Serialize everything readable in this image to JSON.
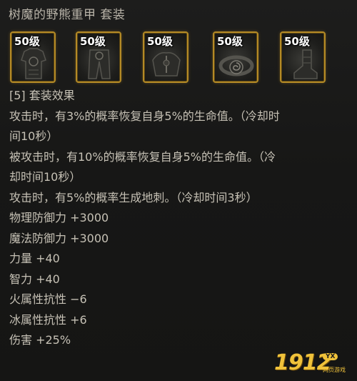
{
  "set": {
    "title": "树魔的野熊重甲  套装",
    "slots": [
      {
        "level": "50级",
        "icon": "armor-chest-icon"
      },
      {
        "level": "50级",
        "icon": "armor-pants-icon"
      },
      {
        "level": "50级",
        "icon": "armor-shoulder-icon"
      },
      {
        "level": "50级",
        "icon": "armor-belt-icon"
      },
      {
        "level": "50级",
        "icon": "armor-boots-icon"
      }
    ]
  },
  "effects": {
    "header": "[5] 套装效果",
    "lines": [
      "攻击时，有3%的概率恢复自身5%的生命值。（冷却时",
      "间10秒）",
      "被攻击时，有10%的概率恢复自身5%的生命值。（冷",
      "却时间10秒）",
      "攻击时，有5%的概率生成地刺。（冷却时间3秒）"
    ]
  },
  "stats": [
    "物理防御力 +3000",
    "魔法防御力 +3000",
    "力量 +40",
    "智力 +40",
    "火属性抗性 −6",
    "冰属性抗性 +6",
    "伤害 +25%"
  ],
  "watermark": {
    "number": "1912",
    "badge": "YX",
    "subtitle": "网页游戏"
  },
  "colors": {
    "slot_border": "#b48a26",
    "text": "#c6c1b5",
    "watermark": "#f0c23a"
  }
}
